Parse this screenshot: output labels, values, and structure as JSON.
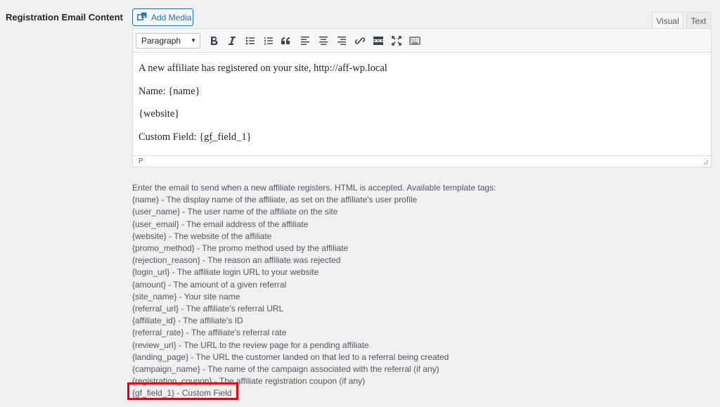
{
  "field_label": "Registration Email Content",
  "add_media_label": "Add Media",
  "tabs": {
    "visual": "Visual",
    "text": "Text"
  },
  "toolbar": {
    "format_select": "Paragraph",
    "buttons": [
      "bold",
      "italic",
      "bulleted-list",
      "numbered-list",
      "blockquote",
      "align-left",
      "align-center",
      "align-right",
      "insert-link",
      "read-more",
      "fullscreen",
      "toolbar-toggle"
    ]
  },
  "editor_content": [
    "A new affiliate has registered on your site, http://aff-wp.local",
    "Name: {name}",
    "{website}",
    "Custom Field: {gf_field_1}"
  ],
  "editor_content_parts": {
    "custom_prefix": "Custom Field: {",
    "custom_flag": "gf",
    "custom_suffix": "_field_1}"
  },
  "status_path": "P",
  "description": {
    "intro": "Enter the email to send when a new affiliate registers. HTML is accepted. Available template tags:",
    "tags": [
      "{name} - The display name of the affiliate, as set on the affiliate's user profile",
      "{user_name} - The user name of the affiliate on the site",
      "{user_email} - The email address of the affiliate",
      "{website} - The website of the affiliate",
      "{promo_method} - The promo method used by the affiliate",
      "{rejection_reason} - The reason an affiliate was rejected",
      "{login_url} - The affiliate login URL to your website",
      "{amount} - The amount of a given referral",
      "{site_name} - Your site name",
      "{referral_url} - The affiliate's referral URL",
      "{affiliate_id} - The affiliate's ID",
      "{referral_rate} - The affiliate's referral rate",
      "{review_url} - The URL to the review page for a pending affiliate",
      "{landing_page} - The URL the customer landed on that led to a referral being created",
      "{campaign_name} - The name of the campaign associated with the referral (if any)",
      "{registration_coupon} - The affiliate registration coupon (if any)",
      "{gf_field_1} - Custom Field"
    ]
  },
  "colors": {
    "accent": "#2271b1",
    "highlight": "#e0000f",
    "background": "#f0f0f1"
  }
}
